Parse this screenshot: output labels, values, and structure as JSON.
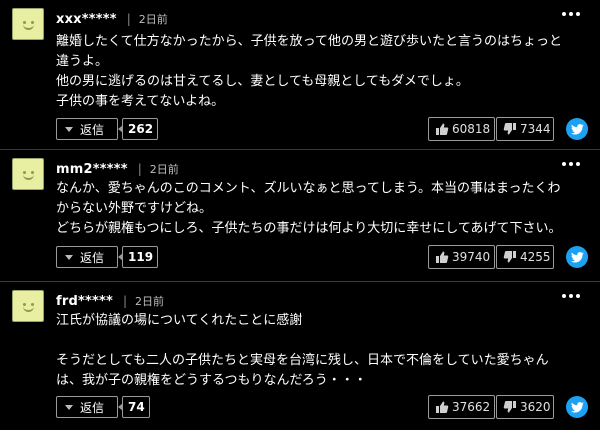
{
  "ui": {
    "reply_label": "返信",
    "separator": "|"
  },
  "comments": [
    {
      "user": "xxx*****",
      "time": "2日前",
      "lines": [
        "離婚したくて仕方なかったから、子供を放って他の男と遊び歩いたと言うのはちょっと",
        "違うよ。",
        "他の男に逃げるのは甘えてるし、妻としても母親としてもダメでしょ。",
        "子供の事を考えてないよね。"
      ],
      "reply_count": "262",
      "likes": "60818",
      "dislikes": "7344"
    },
    {
      "user": "mm2*****",
      "time": "2日前",
      "lines": [
        "なんか、愛ちゃんのこのコメント、ズルいなぁと思ってしまう。本当の事はまったくわ",
        "からない外野ですけどね。",
        "どちらが親権もつにしろ、子供たちの事だけは何より大切に幸せにしてあげて下さい。"
      ],
      "reply_count": "119",
      "likes": "39740",
      "dislikes": "4255"
    },
    {
      "user": "frd*****",
      "time": "2日前",
      "lines": [
        "江氏が協議の場についてくれたことに感謝",
        "",
        "そうだとしても二人の子供たちと実母を台湾に残し、日本で不倫をしていた愛ちゃん",
        "は、我が子の親権をどうするつもりなんだろう・・・"
      ],
      "reply_count": "74",
      "likes": "37662",
      "dislikes": "3620"
    }
  ],
  "colors": {
    "background": "#000000",
    "avatar": "#e8eea2",
    "twitter": "#1da1f2",
    "border": "#9a9a9a"
  }
}
